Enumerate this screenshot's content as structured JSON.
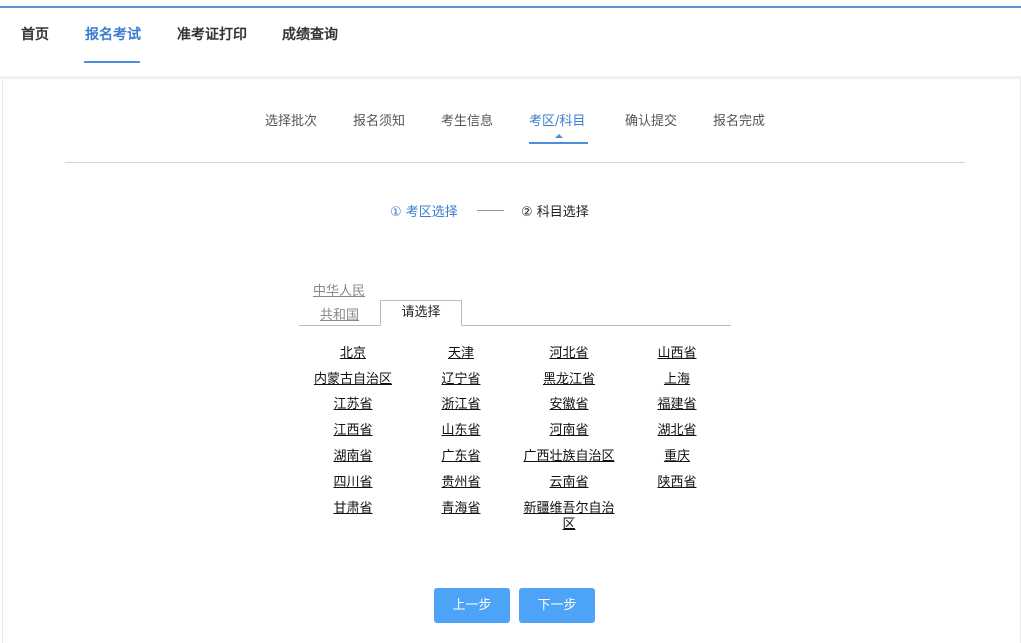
{
  "topnav": {
    "items": [
      {
        "label": "首页",
        "active": false
      },
      {
        "label": "报名考试",
        "active": true
      },
      {
        "label": "准考证打印",
        "active": false
      },
      {
        "label": "成绩查询",
        "active": false
      }
    ]
  },
  "steps": {
    "items": [
      {
        "label": "选择批次",
        "active": false
      },
      {
        "label": "报名须知",
        "active": false
      },
      {
        "label": "考生信息",
        "active": false
      },
      {
        "label": "考区/科目",
        "active": true
      },
      {
        "label": "确认提交",
        "active": false
      },
      {
        "label": "报名完成",
        "active": false
      }
    ]
  },
  "substeps": {
    "first": "① 考区选择",
    "second": "② 科目选择"
  },
  "tabs": {
    "country_line1": "中华人民",
    "country_line2": "共和国",
    "active": "请选择"
  },
  "regions": [
    "北京",
    "天津",
    "河北省",
    "山西省",
    "内蒙古自治区",
    "辽宁省",
    "黑龙江省",
    "上海",
    "江苏省",
    "浙江省",
    "安徽省",
    "福建省",
    "江西省",
    "山东省",
    "河南省",
    "湖北省",
    "湖南省",
    "广东省",
    "广西壮族自治区",
    "重庆",
    "四川省",
    "贵州省",
    "云南省",
    "陕西省",
    "甘肃省",
    "青海省",
    "新疆维吾尔自治区"
  ],
  "buttons": {
    "prev": "上一步",
    "next": "下一步"
  },
  "colors": {
    "accent": "#3a7dd0",
    "button": "#4da3f7"
  }
}
